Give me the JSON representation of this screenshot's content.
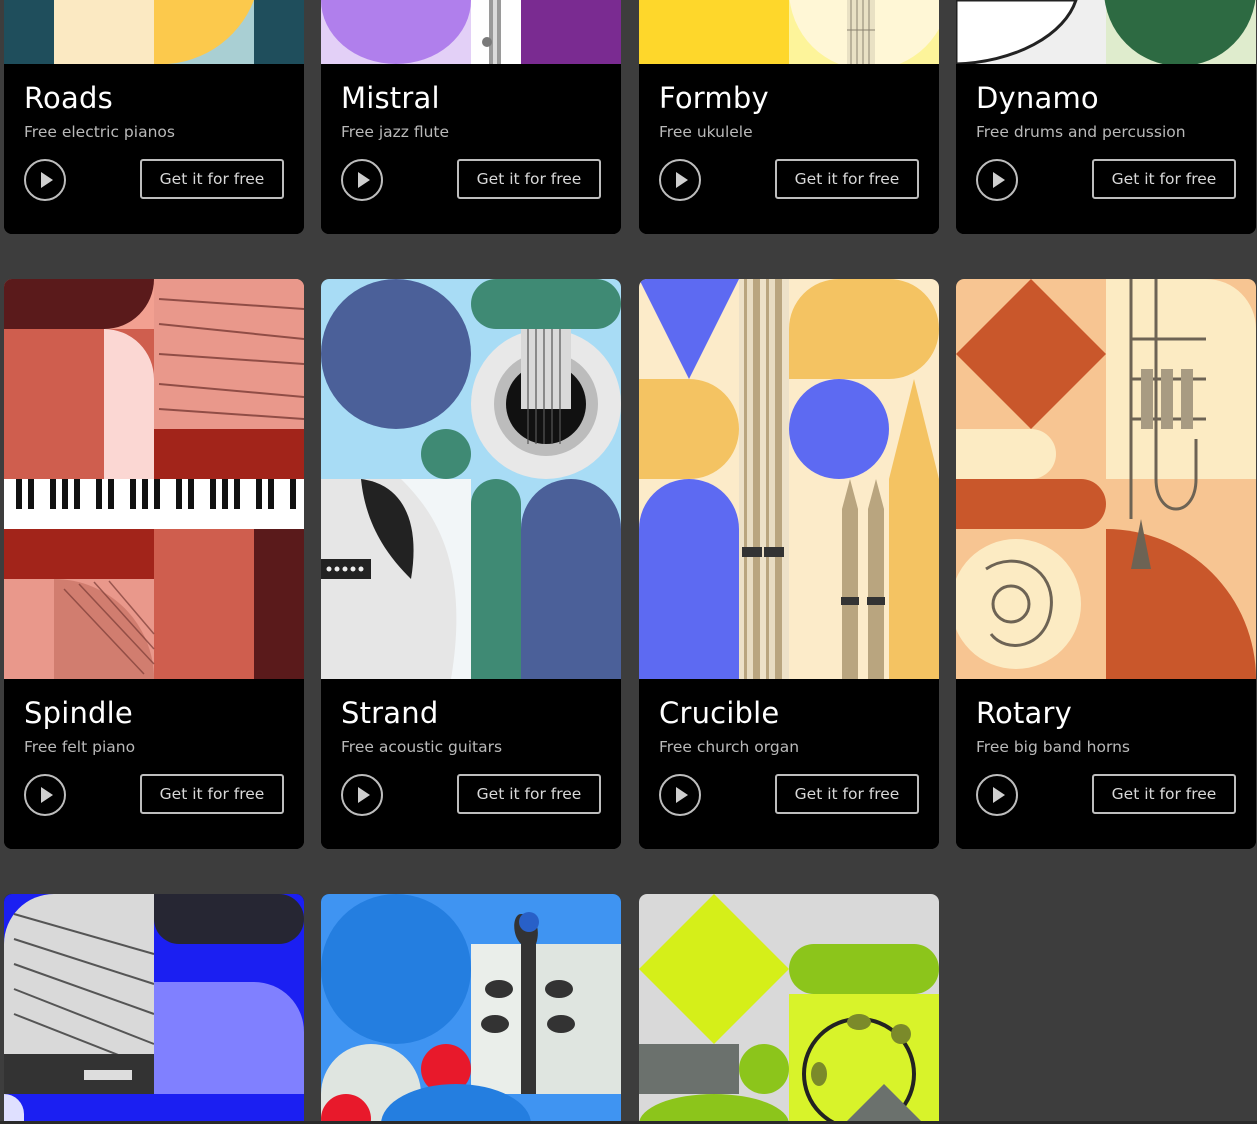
{
  "cards": [
    {
      "name": "Roads",
      "desc": "Free electric pianos",
      "cta": "Get it for free"
    },
    {
      "name": "Mistral",
      "desc": "Free jazz flute",
      "cta": "Get it for free"
    },
    {
      "name": "Formby",
      "desc": "Free ukulele",
      "cta": "Get it for free"
    },
    {
      "name": "Dynamo",
      "desc": "Free drums and percussion",
      "cta": "Get it for free"
    },
    {
      "name": "Spindle",
      "desc": "Free felt piano",
      "cta": "Get it for free"
    },
    {
      "name": "Strand",
      "desc": "Free acoustic guitars",
      "cta": "Get it for free"
    },
    {
      "name": "Crucible",
      "desc": "Free church organ",
      "cta": "Get it for free"
    },
    {
      "name": "Rotary",
      "desc": "Free big band horns",
      "cta": "Get it for free"
    }
  ],
  "icons": {
    "play": "play-icon"
  },
  "colors": {
    "page_bg": "#3d3d3d",
    "card_bg": "#000000",
    "button_border": "#bdbdbd",
    "text_primary": "#ffffff",
    "text_secondary": "#b9b9b9"
  }
}
